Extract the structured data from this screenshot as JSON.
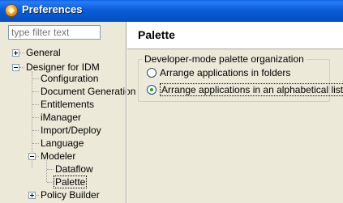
{
  "window": {
    "title": "Preferences"
  },
  "filter": {
    "placeholder": "type filter text"
  },
  "tree": {
    "general": "General",
    "designer": "Designer for IDM",
    "configuration": "Configuration",
    "document_generation": "Document Generation",
    "entitlements": "Entitlements",
    "imanager": "iManager",
    "import_deploy": "Import/Deploy",
    "language": "Language",
    "modeler": "Modeler",
    "dataflow": "Dataflow",
    "palette": "Palette",
    "policy_builder": "Policy Builder"
  },
  "page": {
    "title": "Palette",
    "group_label": "Developer-mode palette organization",
    "options": [
      {
        "label": "Arrange applications in folders",
        "selected": false
      },
      {
        "label": "Arrange applications in an alphabetical list",
        "selected": true
      }
    ]
  }
}
